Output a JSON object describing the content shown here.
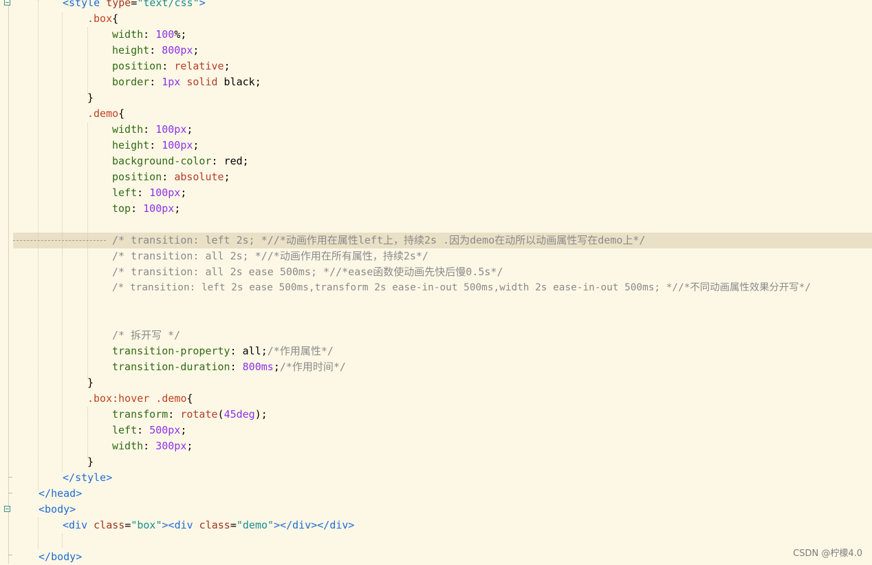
{
  "code": {
    "style_open": {
      "lt": "<",
      "tag": "style",
      "attr": "type",
      "eq": "=",
      "val": "\"text/css\"",
      "gt": ">"
    },
    "box_selector": {
      "sel": ".box",
      "brace": "{"
    },
    "box_props": [
      {
        "prop": "width",
        "colon": ": ",
        "num": "100",
        "unit": "%",
        "semi": ";"
      },
      {
        "prop": "height",
        "colon": ": ",
        "num": "800px",
        "semi": ";"
      },
      {
        "prop": "position",
        "colon": ": ",
        "kw": "relative",
        "semi": ";"
      },
      {
        "prop": "border",
        "colon": ": ",
        "num": "1px",
        "kw": " solid",
        "txt": " black",
        "semi": ";"
      }
    ],
    "close_brace": "}",
    "demo_selector": {
      "sel": ".demo",
      "brace": "{"
    },
    "demo_props": [
      {
        "prop": "width",
        "colon": ": ",
        "num": "100px",
        "semi": ";"
      },
      {
        "prop": "height",
        "colon": ": ",
        "num": "100px",
        "semi": ";"
      },
      {
        "prop": "background-color",
        "colon": ": ",
        "txt": "red",
        "semi": ";"
      },
      {
        "prop": "position",
        "colon": ": ",
        "kw": "absolute",
        "semi": ";"
      },
      {
        "prop": "left",
        "colon": ": ",
        "num": "100px",
        "semi": ";"
      },
      {
        "prop": "top",
        "colon": ": ",
        "num": "100px",
        "semi": ";"
      }
    ],
    "comments": [
      "/* transition: left 2s; *//*动画作用在属性left上，持续2s .因为demo在动所以动画属性写在demo上*/",
      "/* transition: all 2s; *//*动画作用在所有属性，持续2s*/",
      "/* transition: all 2s ease 500ms; *//*ease函数使动画先快后慢0.5s*/",
      "/* transition: left 2s ease 500ms,transform 2s ease-in-out 500ms,width 2s ease-in-out 500ms; *//*不同动画属性效果分开写*/"
    ],
    "split_comment": "/* 拆开写 */",
    "transition_property": {
      "prop": "transition-property",
      "colon": ": ",
      "val": "all",
      "semi": ";",
      "comment": "/*作用属性*/"
    },
    "transition_duration": {
      "prop": "transition-duration",
      "colon": ": ",
      "val": "800ms",
      "semi": ";",
      "comment": "/*作用时间*/"
    },
    "hover_selector": {
      "sel": ".box:hover .demo",
      "brace": "{"
    },
    "transform": {
      "prop": "transform",
      "colon": ": ",
      "fn": "rotate",
      "paren_open": "(",
      "val": "45deg",
      "paren_close": ")",
      "semi": ";"
    },
    "hover_left": {
      "prop": "left",
      "colon": ": ",
      "num": "500px",
      "semi": ";"
    },
    "hover_width": {
      "prop": "width",
      "colon": ": ",
      "num": "300px",
      "semi": ";"
    },
    "style_close": {
      "lt": "</",
      "tag": "style",
      "gt": ">"
    },
    "head_close": {
      "lt": "</",
      "tag": "head",
      "gt": ">"
    },
    "body_open": {
      "lt": "<",
      "tag": "body",
      "gt": ">"
    },
    "div_line": {
      "lt1": "<",
      "tag1": "div",
      "attr1": " class",
      "eq1": "=",
      "val1": "\"box\"",
      "gt1": ">",
      "lt2": "<",
      "tag2": "div",
      "attr2": " class",
      "eq2": "=",
      "val2": "\"demo\"",
      "gt2": ">",
      "close1": "</div>",
      "close2": "</div>"
    },
    "body_close": {
      "lt": "</",
      "tag": "body",
      "gt": ">"
    }
  },
  "watermark": "CSDN @柠檬4.0",
  "colors": {
    "background": "#fdf8e6",
    "highlight_line": "#e9e0c6",
    "tag": "#1e6ad2",
    "attribute": "#a2331f",
    "attribute_value": "#1a8c8f",
    "selector": "#c04020",
    "property": "#2f6a13",
    "number": "#8b31e8",
    "keyword": "#b43c28",
    "comment": "#8a8a8a"
  }
}
